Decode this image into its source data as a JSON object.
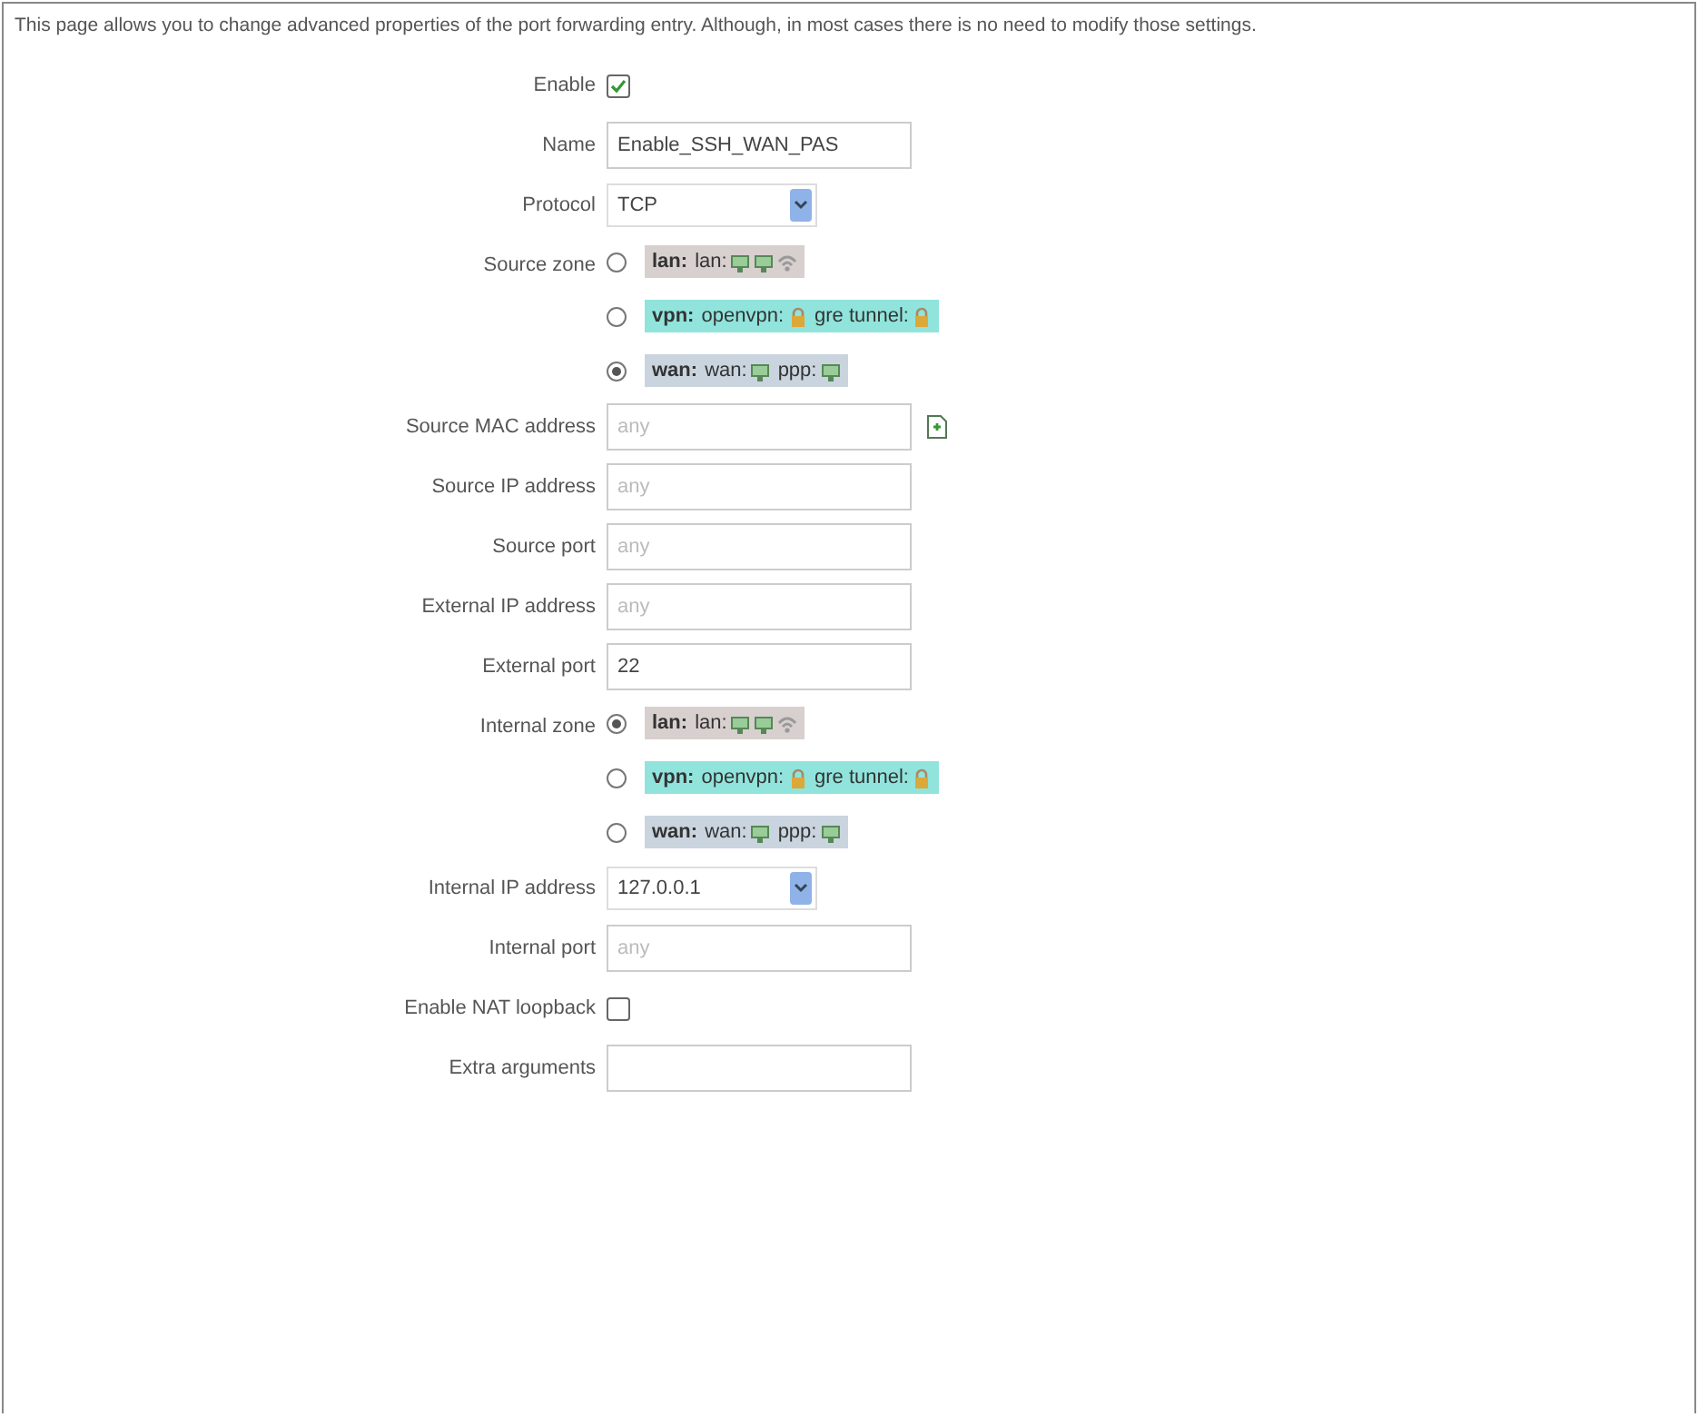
{
  "description": "This page allows you to change advanced properties of the port forwarding entry. Although, in most cases there is no need to modify those settings.",
  "fields": [
    {
      "kind": "checkbox",
      "label": "Enable",
      "checked": true
    },
    {
      "kind": "text",
      "label": "Name",
      "value": "Enable_SSH_WAN_PAS"
    },
    {
      "kind": "select",
      "label": "Protocol",
      "value": "TCP"
    },
    {
      "kind": "zones",
      "label": "Source zone",
      "options": [
        {
          "zone": "lan:",
          "color": "#d8cfcf",
          "selected": false,
          "networks": [
            {
              "name": "lan:",
              "icons": [
                {
                  "kind": "ethernet"
                },
                {
                  "kind": "ethernet"
                },
                {
                  "kind": "wifi"
                }
              ]
            }
          ]
        },
        {
          "zone": "vpn:",
          "color": "#90e4dc",
          "selected": false,
          "networks": [
            {
              "name": "openvpn:",
              "icons": [
                {
                  "kind": "tunnel"
                }
              ]
            },
            {
              "name": "gre tunnel:",
              "icons": [
                {
                  "kind": "tunnel"
                }
              ]
            }
          ]
        },
        {
          "zone": "wan:",
          "color": "#c9d4de",
          "selected": true,
          "networks": [
            {
              "name": "wan:",
              "icons": [
                {
                  "kind": "ethernet"
                }
              ]
            },
            {
              "name": "ppp:",
              "icons": [
                {
                  "kind": "ethernet"
                }
              ]
            }
          ]
        }
      ]
    },
    {
      "kind": "text",
      "label": "Source MAC address",
      "placeholder": "any",
      "add": true
    },
    {
      "kind": "text",
      "label": "Source IP address",
      "placeholder": "any"
    },
    {
      "kind": "text",
      "label": "Source port",
      "placeholder": "any"
    },
    {
      "kind": "text",
      "label": "External IP address",
      "placeholder": "any"
    },
    {
      "kind": "text",
      "label": "External port",
      "value": "22"
    },
    {
      "kind": "zones",
      "label": "Internal zone",
      "options": [
        {
          "zone": "lan:",
          "color": "#d8cfcf",
          "selected": true,
          "networks": [
            {
              "name": "lan:",
              "icons": [
                {
                  "kind": "ethernet"
                },
                {
                  "kind": "ethernet"
                },
                {
                  "kind": "wifi"
                }
              ]
            }
          ]
        },
        {
          "zone": "vpn:",
          "color": "#90e4dc",
          "selected": false,
          "networks": [
            {
              "name": "openvpn:",
              "icons": [
                {
                  "kind": "tunnel"
                }
              ]
            },
            {
              "name": "gre tunnel:",
              "icons": [
                {
                  "kind": "tunnel"
                }
              ]
            }
          ]
        },
        {
          "zone": "wan:",
          "color": "#c9d4de",
          "selected": false,
          "networks": [
            {
              "name": "wan:",
              "icons": [
                {
                  "kind": "ethernet"
                }
              ]
            },
            {
              "name": "ppp:",
              "icons": [
                {
                  "kind": "ethernet"
                }
              ]
            }
          ]
        }
      ]
    },
    {
      "kind": "select",
      "label": "Internal IP address",
      "value": "127.0.0.1"
    },
    {
      "kind": "text",
      "label": "Internal port",
      "placeholder": "any"
    },
    {
      "kind": "checkbox",
      "label": "Enable NAT loopback",
      "checked": false
    },
    {
      "kind": "text",
      "label": "Extra arguments"
    }
  ]
}
